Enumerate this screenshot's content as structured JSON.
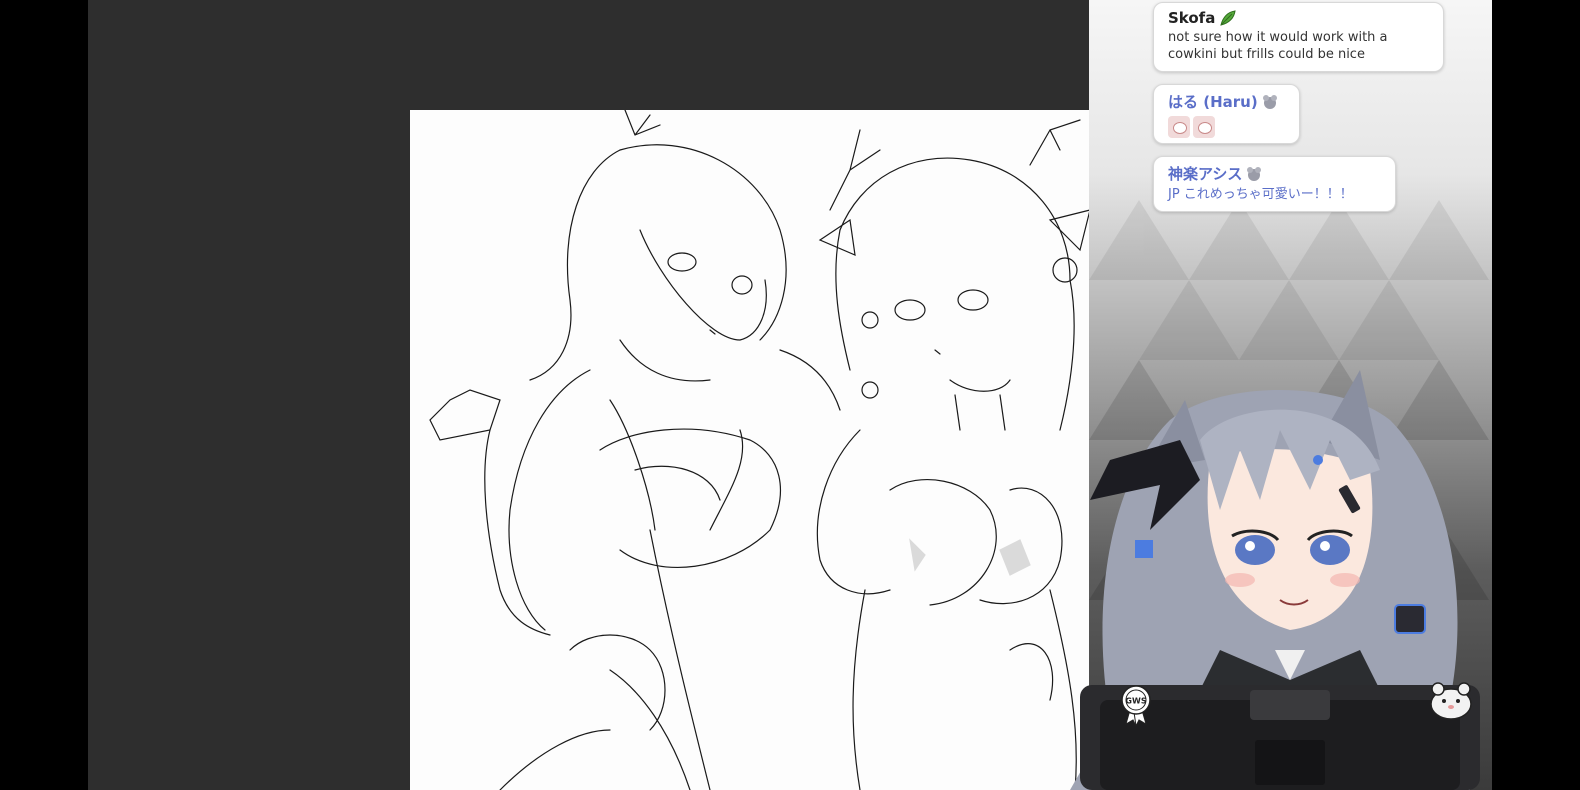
{
  "chat": {
    "messages": [
      {
        "author": "Skofa",
        "author_icon": "leaf-icon",
        "text": "not sure how it would work with a cowkini but frills could be nice"
      },
      {
        "author": "はる (Haru)",
        "author_icon": "mouse-badge-icon",
        "text": "",
        "emotes": [
          "haru-emote",
          "haru-emote"
        ]
      },
      {
        "author": "神楽アシス",
        "author_icon": "mouse-badge-icon",
        "text": "JP これめっちゃ可愛いー！！！"
      }
    ]
  },
  "overlay": {
    "left_badge": "GWS",
    "right_badge_icon": "mascot-icon"
  },
  "colors": {
    "workspace_bg": "#2e2e2e",
    "canvas_bg": "#fdfdfd",
    "chat_accent": "#5a6ec8"
  }
}
